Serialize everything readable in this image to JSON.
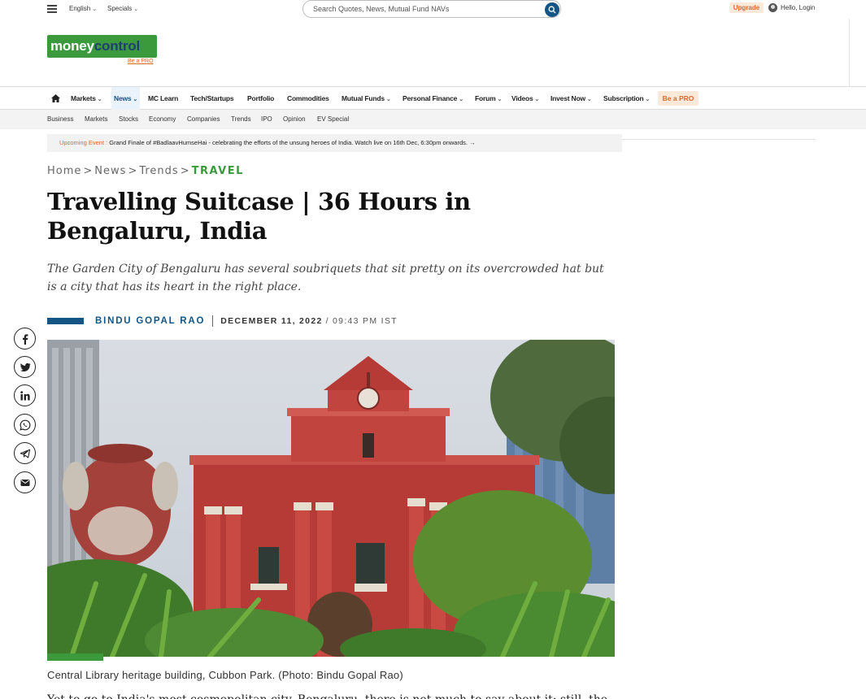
{
  "topbar": {
    "language": "English",
    "specials": "Specials",
    "search_placeholder": "Search Quotes, News, Mutual Fund NAVs",
    "upgrade": "Upgrade",
    "login": "Hello, Login"
  },
  "logo": {
    "text_a": "money",
    "text_b": "control",
    "bepro": "Be a PRO"
  },
  "nav": {
    "items": [
      "Markets",
      "News",
      "MC Learn",
      "Tech/Startups",
      "Portfolio",
      "Commodities",
      "Mutual Funds",
      "Personal Finance",
      "Forum",
      "Videos",
      "Invest Now",
      "Subscription"
    ],
    "pro": "Be a PRO"
  },
  "subnav": {
    "items": [
      "Business",
      "Markets",
      "Stocks",
      "Economy",
      "Companies",
      "Trends",
      "IPO",
      "Opinion",
      "EV Special"
    ]
  },
  "event": {
    "label": "Upcoming Event :",
    "text": "Grand Finale of #BadlaavHumseHai - celebrating the efforts of the unsung heroes of India. Watch live on 16th Dec, 6:30pm onwards.",
    "arrow": "→"
  },
  "breadcrumb": {
    "home": "Home",
    "news": "News",
    "trends": "Trends",
    "current": "TRAVEL",
    "sep": ">"
  },
  "article": {
    "title": "Travelling Suitcase | 36 Hours in Bengaluru, India",
    "subtitle": "The Garden City of Bengaluru has several soubriquets that sit pretty on its overcrowded hat but is a city that has its heart in the right place.",
    "author": "BINDU GOPAL RAO",
    "date": "DECEMBER 11, 2022",
    "time": "/ 09:43 PM IST",
    "caption": "Central Library heritage building, Cubbon Park. (Photo: Bindu Gopal Rao)",
    "body_first_line": "Yet to go to India's most cosmopolitan city, Bengaluru, there is not much to say about it; still, the"
  },
  "share": [
    "facebook-icon",
    "twitter-icon",
    "linkedin-icon",
    "whatsapp-icon",
    "telegram-icon",
    "email-icon"
  ],
  "colors": {
    "brand_green": "#3a9a3c",
    "brand_blue": "#135686",
    "accent_orange": "#e0682a"
  }
}
